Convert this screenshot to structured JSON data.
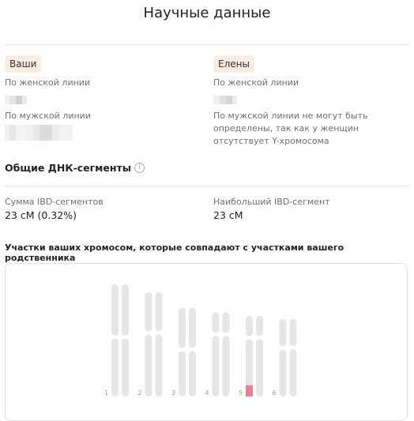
{
  "page": {
    "title": "Научные данные"
  },
  "you": {
    "badge": "Ваши",
    "maternal_label": "По женской линии",
    "paternal_label": "По мужской линии"
  },
  "relative": {
    "badge": "Елены",
    "maternal_label": "По женской линии",
    "paternal_note": "По мужской линии не могут быть определены, так как у женщин отсутствует Y-хромосома"
  },
  "shared": {
    "heading": "Общие ДНК-сегменты",
    "ibd_sum_label": "Сумма IBD-сегментов",
    "ibd_sum_value": "23 сМ (0.32%)",
    "ibd_max_label": "Наибольший IBD-сегмент",
    "ibd_max_value": "23 сМ"
  },
  "chromosomes": {
    "heading": "Участки ваших хромосом, которые совпадают с участками вашего родственника",
    "items": [
      {
        "number": "1",
        "length": 1.0,
        "centromere": 0.47,
        "match": null
      },
      {
        "number": "2",
        "length": 0.93,
        "centromere": 0.39,
        "match": null
      },
      {
        "number": "3",
        "length": 0.79,
        "centromere": 0.47,
        "match": null
      },
      {
        "number": "4",
        "length": 0.75,
        "centromere": 0.26,
        "match": null
      },
      {
        "number": "5",
        "length": 0.72,
        "centromere": 0.27,
        "match": [
          0.62,
          0.72
        ]
      },
      {
        "number": "6",
        "length": 0.69,
        "centromere": 0.37,
        "match": null
      }
    ],
    "chrom_color": "#e6e6e6",
    "match_color": "#ef7c92"
  }
}
